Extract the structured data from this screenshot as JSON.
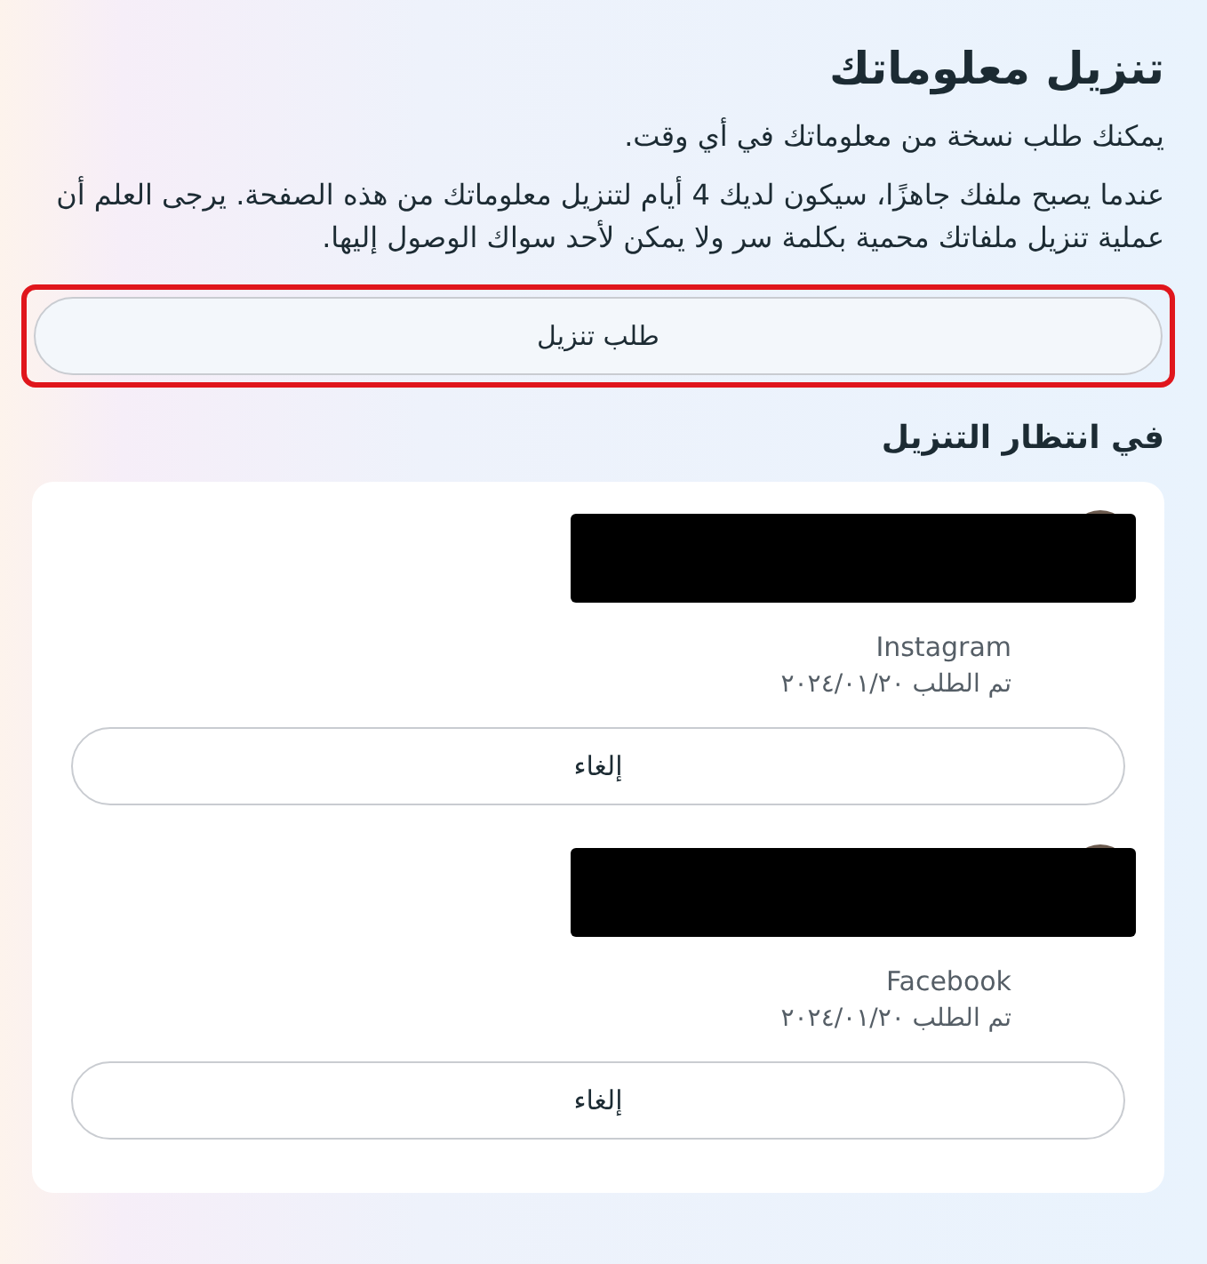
{
  "header": {
    "title": "تنزيل معلوماتك",
    "intro": "يمكنك طلب نسخة من معلوماتك في أي وقت.",
    "notice": "عندما يصبح ملفك جاهزًا، سيكون لديك 4 أيام لتنزيل معلوماتك من هذه الصفحة. يرجى العلم أن عملية تنزيل ملفاتك محمية بكلمة سر ولا يمكن لأحد سواك الوصول إليها."
  },
  "request_button": {
    "label": "طلب تنزيل",
    "highlighted": true
  },
  "pending": {
    "heading": "في انتظار التنزيل",
    "items": [
      {
        "redacted": true,
        "source": "Instagram",
        "requested": "تم الطلب ٢٠٢٤/٠١/٢٠",
        "cancel_label": "إلغاء"
      },
      {
        "redacted": true,
        "source": "Facebook",
        "requested": "تم الطلب ٢٠٢٤/٠١/٢٠",
        "cancel_label": "إلغاء"
      }
    ]
  }
}
